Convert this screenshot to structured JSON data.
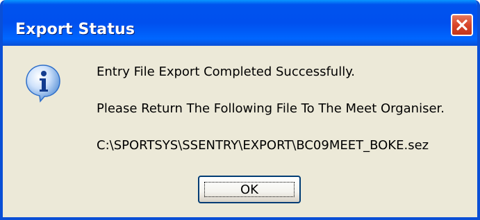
{
  "window": {
    "title": "Export Status",
    "close_icon": "close-icon"
  },
  "dialog": {
    "icon": "information-icon",
    "messages": [
      "Entry File Export Completed Successfully.",
      "Please Return The Following File To The Meet Organiser.",
      "C:\\SPORTSYS\\SSENTRY\\EXPORT\\BC09MEET_BOKE.sez"
    ],
    "ok_label": "OK"
  },
  "colors": {
    "titlebar": "#0053ee",
    "frame": "#0a4fd6",
    "body": "#ece9d8",
    "close_button": "#d8452a",
    "info_icon": "#2f6fc9"
  }
}
